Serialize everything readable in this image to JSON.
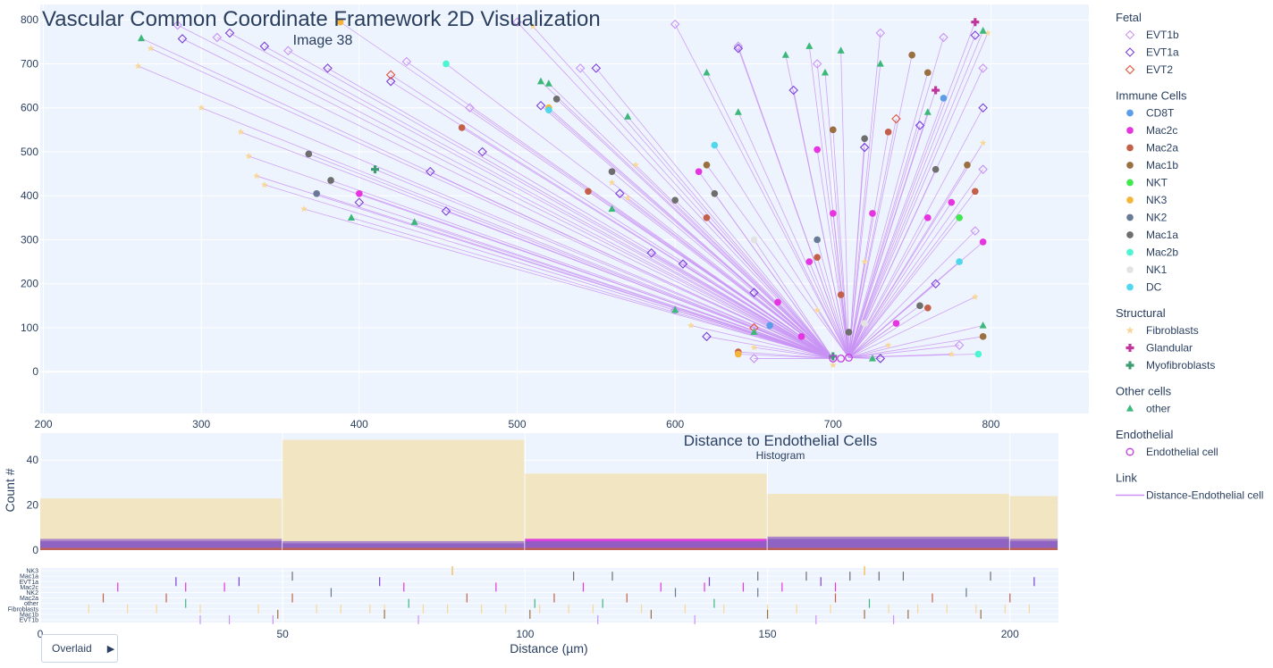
{
  "title": "Vascular Common Coordinate Framework 2D Visualization",
  "scatter_panel": {
    "subtitle": "Image 38"
  },
  "histogram_panel": {
    "title": "Distance to Endothelial Cells",
    "subtitle": "Histogram",
    "ylabel": "Count #",
    "xlabel": "Distance (µm)"
  },
  "button": {
    "label": "Overlaid",
    "icon": "play-triangle-icon"
  },
  "legend": [
    {
      "group": "Fetal",
      "items": [
        {
          "name": "EVT1b",
          "symbol": "diamond-open",
          "color": "#c993f5"
        },
        {
          "name": "EVT1a",
          "symbol": "diamond-open",
          "color": "#7b3fd9"
        },
        {
          "name": "EVT2",
          "symbol": "diamond-open",
          "color": "#e0533a"
        }
      ]
    },
    {
      "group": "Immune Cells",
      "items": [
        {
          "name": "CD8T",
          "symbol": "circle",
          "color": "#5c9de8"
        },
        {
          "name": "Mac2c",
          "symbol": "circle",
          "color": "#e534e0"
        },
        {
          "name": "Mac2a",
          "symbol": "circle",
          "color": "#c4604a"
        },
        {
          "name": "Mac1b",
          "symbol": "circle",
          "color": "#9b7040"
        },
        {
          "name": "NKT",
          "symbol": "circle",
          "color": "#3fe84d"
        },
        {
          "name": "NK3",
          "symbol": "circle",
          "color": "#f5b43a"
        },
        {
          "name": "NK2",
          "symbol": "circle",
          "color": "#687a96"
        },
        {
          "name": "Mac1a",
          "symbol": "circle",
          "color": "#6e6e6e"
        },
        {
          "name": "Mac2b",
          "symbol": "circle",
          "color": "#4ef5d2"
        },
        {
          "name": "NK1",
          "symbol": "circle",
          "color": "#e3e3e3"
        },
        {
          "name": "DC",
          "symbol": "circle",
          "color": "#4fd8ec"
        }
      ]
    },
    {
      "group": "Structural",
      "items": [
        {
          "name": "Fibroblasts",
          "symbol": "star",
          "color": "#f8d79a"
        },
        {
          "name": "Glandular",
          "symbol": "cross",
          "color": "#c0349e"
        },
        {
          "name": "Myofibroblasts",
          "symbol": "cross",
          "color": "#3e9c72"
        }
      ]
    },
    {
      "group": "Other cells",
      "items": [
        {
          "name": "other",
          "symbol": "triangle",
          "color": "#3cb87a"
        }
      ]
    },
    {
      "group": "Endothelial",
      "items": [
        {
          "name": "Endothelial cell",
          "symbol": "circle-open",
          "color": "#c23fe0"
        }
      ]
    },
    {
      "group": "Link",
      "items": [
        {
          "name": "Distance-Endothelial cell",
          "symbol": "line",
          "color": "#c993f5"
        }
      ]
    }
  ],
  "chart_data": [
    {
      "type": "scatter",
      "title": "Image 38",
      "x_ticks": [
        200,
        300,
        400,
        500,
        600,
        700,
        800
      ],
      "y_ticks": [
        0,
        100,
        200,
        300,
        400,
        500,
        600,
        700,
        800
      ],
      "xlim": [
        198,
        862
      ],
      "ylim": [
        -95,
        835
      ],
      "link_color": "#c993f5",
      "endothelial_cells": [
        [
          700,
          30
        ],
        [
          705,
          30
        ],
        [
          710,
          32
        ]
      ],
      "points": [
        {
          "cell": "EVT1b",
          "x": 285,
          "y": 788
        },
        {
          "cell": "EVT1b",
          "x": 310,
          "y": 760
        },
        {
          "cell": "EVT1b",
          "x": 355,
          "y": 730
        },
        {
          "cell": "EVT1b",
          "x": 430,
          "y": 705
        },
        {
          "cell": "EVT1b",
          "x": 500,
          "y": 795
        },
        {
          "cell": "EVT1b",
          "x": 540,
          "y": 690
        },
        {
          "cell": "EVT1b",
          "x": 600,
          "y": 790
        },
        {
          "cell": "EVT1b",
          "x": 640,
          "y": 740
        },
        {
          "cell": "EVT1b",
          "x": 690,
          "y": 700
        },
        {
          "cell": "EVT1b",
          "x": 730,
          "y": 770
        },
        {
          "cell": "EVT1b",
          "x": 770,
          "y": 760
        },
        {
          "cell": "EVT1b",
          "x": 795,
          "y": 690
        },
        {
          "cell": "EVT1b",
          "x": 795,
          "y": 460
        },
        {
          "cell": "EVT1b",
          "x": 790,
          "y": 320
        },
        {
          "cell": "EVT1b",
          "x": 600,
          "y": 140
        },
        {
          "cell": "EVT1b",
          "x": 650,
          "y": 30
        },
        {
          "cell": "EVT1b",
          "x": 780,
          "y": 60
        },
        {
          "cell": "EVT1b",
          "x": 470,
          "y": 600
        },
        {
          "cell": "EVT1a",
          "x": 288,
          "y": 757
        },
        {
          "cell": "EVT1a",
          "x": 318,
          "y": 770
        },
        {
          "cell": "EVT1a",
          "x": 380,
          "y": 690
        },
        {
          "cell": "EVT1a",
          "x": 420,
          "y": 660
        },
        {
          "cell": "EVT1a",
          "x": 445,
          "y": 455
        },
        {
          "cell": "EVT1a",
          "x": 478,
          "y": 500
        },
        {
          "cell": "EVT1a",
          "x": 515,
          "y": 605
        },
        {
          "cell": "EVT1a",
          "x": 550,
          "y": 690
        },
        {
          "cell": "EVT1a",
          "x": 565,
          "y": 405
        },
        {
          "cell": "EVT1a",
          "x": 585,
          "y": 270
        },
        {
          "cell": "EVT1a",
          "x": 605,
          "y": 245
        },
        {
          "cell": "EVT1a",
          "x": 640,
          "y": 735
        },
        {
          "cell": "EVT1a",
          "x": 650,
          "y": 180
        },
        {
          "cell": "EVT1a",
          "x": 675,
          "y": 640
        },
        {
          "cell": "EVT1a",
          "x": 720,
          "y": 510
        },
        {
          "cell": "EVT1a",
          "x": 755,
          "y": 560
        },
        {
          "cell": "EVT1a",
          "x": 790,
          "y": 765
        },
        {
          "cell": "EVT1a",
          "x": 795,
          "y": 600
        },
        {
          "cell": "EVT1a",
          "x": 765,
          "y": 200
        },
        {
          "cell": "EVT1a",
          "x": 620,
          "y": 80
        },
        {
          "cell": "EVT1a",
          "x": 730,
          "y": 30
        },
        {
          "cell": "EVT1a",
          "x": 400,
          "y": 385
        },
        {
          "cell": "EVT1a",
          "x": 455,
          "y": 365
        },
        {
          "cell": "EVT1a",
          "x": 340,
          "y": 740
        },
        {
          "cell": "EVT2",
          "x": 420,
          "y": 675
        },
        {
          "cell": "EVT2",
          "x": 740,
          "y": 575
        },
        {
          "cell": "EVT2",
          "x": 650,
          "y": 100
        },
        {
          "cell": "CD8T",
          "x": 660,
          "y": 105
        },
        {
          "cell": "CD8T",
          "x": 770,
          "y": 622
        },
        {
          "cell": "Mac2c",
          "x": 400,
          "y": 405
        },
        {
          "cell": "Mac2c",
          "x": 615,
          "y": 455
        },
        {
          "cell": "Mac2c",
          "x": 665,
          "y": 158
        },
        {
          "cell": "Mac2c",
          "x": 690,
          "y": 505
        },
        {
          "cell": "Mac2c",
          "x": 700,
          "y": 360
        },
        {
          "cell": "Mac2c",
          "x": 725,
          "y": 360
        },
        {
          "cell": "Mac2c",
          "x": 760,
          "y": 350
        },
        {
          "cell": "Mac2c",
          "x": 795,
          "y": 295
        },
        {
          "cell": "Mac2c",
          "x": 775,
          "y": 385
        },
        {
          "cell": "Mac2c",
          "x": 740,
          "y": 110
        },
        {
          "cell": "Mac2c",
          "x": 680,
          "y": 80
        },
        {
          "cell": "Mac2c",
          "x": 685,
          "y": 250
        },
        {
          "cell": "Mac2a",
          "x": 465,
          "y": 555
        },
        {
          "cell": "Mac2a",
          "x": 545,
          "y": 410
        },
        {
          "cell": "Mac2a",
          "x": 620,
          "y": 350
        },
        {
          "cell": "Mac2a",
          "x": 705,
          "y": 175
        },
        {
          "cell": "Mac2a",
          "x": 735,
          "y": 545
        },
        {
          "cell": "Mac2a",
          "x": 790,
          "y": 410
        },
        {
          "cell": "Mac2a",
          "x": 760,
          "y": 145
        },
        {
          "cell": "Mac2a",
          "x": 640,
          "y": 45
        },
        {
          "cell": "Mac2a",
          "x": 690,
          "y": 260
        },
        {
          "cell": "Mac1b",
          "x": 620,
          "y": 470
        },
        {
          "cell": "Mac1b",
          "x": 700,
          "y": 550
        },
        {
          "cell": "Mac1b",
          "x": 750,
          "y": 720
        },
        {
          "cell": "Mac1b",
          "x": 785,
          "y": 470
        },
        {
          "cell": "Mac1b",
          "x": 795,
          "y": 80
        },
        {
          "cell": "Mac1b",
          "x": 760,
          "y": 680
        },
        {
          "cell": "NKT",
          "x": 780,
          "y": 350
        },
        {
          "cell": "NK3",
          "x": 388,
          "y": 795
        },
        {
          "cell": "NK3",
          "x": 520,
          "y": 600
        },
        {
          "cell": "NK3",
          "x": 640,
          "y": 40
        },
        {
          "cell": "NK2",
          "x": 373,
          "y": 405
        },
        {
          "cell": "NK2",
          "x": 690,
          "y": 300
        },
        {
          "cell": "Mac1a",
          "x": 368,
          "y": 495
        },
        {
          "cell": "Mac1a",
          "x": 382,
          "y": 435
        },
        {
          "cell": "Mac1a",
          "x": 525,
          "y": 620
        },
        {
          "cell": "Mac1a",
          "x": 560,
          "y": 455
        },
        {
          "cell": "Mac1a",
          "x": 600,
          "y": 390
        },
        {
          "cell": "Mac1a",
          "x": 625,
          "y": 405
        },
        {
          "cell": "Mac1a",
          "x": 720,
          "y": 530
        },
        {
          "cell": "Mac1a",
          "x": 755,
          "y": 150
        },
        {
          "cell": "Mac1a",
          "x": 765,
          "y": 460
        },
        {
          "cell": "Mac1a",
          "x": 710,
          "y": 90
        },
        {
          "cell": "Mac2b",
          "x": 455,
          "y": 700
        },
        {
          "cell": "Mac2b",
          "x": 792,
          "y": 40
        },
        {
          "cell": "NK1",
          "x": 720,
          "y": 110
        },
        {
          "cell": "NK1",
          "x": 650,
          "y": 300
        },
        {
          "cell": "DC",
          "x": 520,
          "y": 595
        },
        {
          "cell": "DC",
          "x": 625,
          "y": 515
        },
        {
          "cell": "DC",
          "x": 780,
          "y": 250
        },
        {
          "cell": "Fibroblasts",
          "x": 260,
          "y": 695
        },
        {
          "cell": "Fibroblasts",
          "x": 268,
          "y": 735
        },
        {
          "cell": "Fibroblasts",
          "x": 300,
          "y": 600
        },
        {
          "cell": "Fibroblasts",
          "x": 325,
          "y": 545
        },
        {
          "cell": "Fibroblasts",
          "x": 330,
          "y": 490
        },
        {
          "cell": "Fibroblasts",
          "x": 335,
          "y": 445
        },
        {
          "cell": "Fibroblasts",
          "x": 340,
          "y": 425
        },
        {
          "cell": "Fibroblasts",
          "x": 365,
          "y": 370
        },
        {
          "cell": "Fibroblasts",
          "x": 510,
          "y": 785
        },
        {
          "cell": "Fibroblasts",
          "x": 560,
          "y": 430
        },
        {
          "cell": "Fibroblasts",
          "x": 570,
          "y": 395
        },
        {
          "cell": "Fibroblasts",
          "x": 610,
          "y": 105
        },
        {
          "cell": "Fibroblasts",
          "x": 650,
          "y": 55
        },
        {
          "cell": "Fibroblasts",
          "x": 700,
          "y": 15
        },
        {
          "cell": "Fibroblasts",
          "x": 735,
          "y": 60
        },
        {
          "cell": "Fibroblasts",
          "x": 775,
          "y": 40
        },
        {
          "cell": "Fibroblasts",
          "x": 790,
          "y": 170
        },
        {
          "cell": "Fibroblasts",
          "x": 795,
          "y": 520
        },
        {
          "cell": "Fibroblasts",
          "x": 798,
          "y": 770
        },
        {
          "cell": "Fibroblasts",
          "x": 720,
          "y": 250
        },
        {
          "cell": "Fibroblasts",
          "x": 575,
          "y": 470
        },
        {
          "cell": "Fibroblasts",
          "x": 690,
          "y": 140
        },
        {
          "cell": "Glandular",
          "x": 790,
          "y": 795
        },
        {
          "cell": "Glandular",
          "x": 765,
          "y": 640
        },
        {
          "cell": "Myofibroblasts",
          "x": 410,
          "y": 460
        },
        {
          "cell": "Myofibroblasts",
          "x": 700,
          "y": 35
        },
        {
          "cell": "other",
          "x": 262,
          "y": 758
        },
        {
          "cell": "other",
          "x": 395,
          "y": 350
        },
        {
          "cell": "other",
          "x": 435,
          "y": 340
        },
        {
          "cell": "other",
          "x": 515,
          "y": 660
        },
        {
          "cell": "other",
          "x": 520,
          "y": 655
        },
        {
          "cell": "other",
          "x": 560,
          "y": 370
        },
        {
          "cell": "other",
          "x": 570,
          "y": 580
        },
        {
          "cell": "other",
          "x": 600,
          "y": 140
        },
        {
          "cell": "other",
          "x": 640,
          "y": 590
        },
        {
          "cell": "other",
          "x": 650,
          "y": 90
        },
        {
          "cell": "other",
          "x": 670,
          "y": 720
        },
        {
          "cell": "other",
          "x": 685,
          "y": 740
        },
        {
          "cell": "other",
          "x": 695,
          "y": 680
        },
        {
          "cell": "other",
          "x": 705,
          "y": 730
        },
        {
          "cell": "other",
          "x": 730,
          "y": 700
        },
        {
          "cell": "other",
          "x": 760,
          "y": 590
        },
        {
          "cell": "other",
          "x": 795,
          "y": 775
        },
        {
          "cell": "other",
          "x": 795,
          "y": 105
        },
        {
          "cell": "other",
          "x": 725,
          "y": 30
        },
        {
          "cell": "other",
          "x": 620,
          "y": 680
        }
      ]
    },
    {
      "type": "bar",
      "title": "Distance to Endothelial Cells",
      "subtitle": "Histogram",
      "ylabel": "Count #",
      "xlabel": "Distance (µm)",
      "x_ticks": [
        0,
        50,
        100,
        150,
        200
      ],
      "y_ticks": [
        0,
        20,
        40
      ],
      "xlim": [
        0,
        210
      ],
      "ylim": [
        0,
        52
      ],
      "bin_edges": [
        0,
        50,
        100,
        150,
        200,
        210
      ],
      "series": [
        {
          "name": "Fibroblasts",
          "color": "#f2e4bb",
          "values": [
            23,
            49,
            34,
            25,
            24
          ]
        },
        {
          "name": "EVT1b",
          "color": "#a57dc9",
          "values": [
            5,
            4,
            5,
            6,
            5
          ]
        },
        {
          "name": "Mac2c",
          "color": "#e534e0",
          "values": [
            0,
            0,
            5,
            0,
            0
          ]
        },
        {
          "name": "EVT1a",
          "color": "#8b5fc0",
          "values": [
            4,
            3,
            4,
            5,
            4
          ]
        },
        {
          "name": "Mac2a",
          "color": "#c4604a",
          "values": [
            1,
            1,
            1,
            1,
            1
          ]
        }
      ]
    },
    {
      "type": "scatter",
      "title": "",
      "categories": [
        "NK3",
        "Mac1a",
        "EVT1a",
        "Mac2c",
        "NK2",
        "Mac2a",
        "other",
        "Fibroblasts",
        "Mac1b",
        "EVT1b"
      ],
      "category_colors": [
        "#f5b43a",
        "#6e6e6e",
        "#7b3fd9",
        "#e534e0",
        "#687a96",
        "#c4604a",
        "#3cb87a",
        "#f8d79a",
        "#9b7040",
        "#c993f5"
      ],
      "rugs": [
        [
          85,
          170
        ],
        [
          52,
          110,
          118,
          148,
          158,
          167,
          173,
          178,
          196
        ],
        [
          28,
          41,
          70,
          138,
          161,
          205
        ],
        [
          16,
          30,
          38,
          75,
          94,
          112,
          128,
          137,
          145,
          153,
          164
        ],
        [
          60,
          131,
          148,
          191
        ],
        [
          13,
          26,
          52,
          88,
          106,
          121,
          164,
          184,
          200
        ],
        [
          30,
          76,
          102,
          116,
          139,
          171
        ],
        [
          10,
          18,
          24,
          33,
          45,
          57,
          62,
          68,
          71,
          79,
          84,
          91,
          96,
          103,
          109,
          114,
          124,
          133,
          141,
          150,
          156,
          163,
          175,
          181,
          187,
          193,
          199,
          204
        ],
        [
          49,
          71,
          101,
          126,
          150,
          170,
          179,
          194
        ],
        [
          33,
          39,
          48,
          78,
          115,
          135,
          160,
          176
        ]
      ]
    }
  ]
}
